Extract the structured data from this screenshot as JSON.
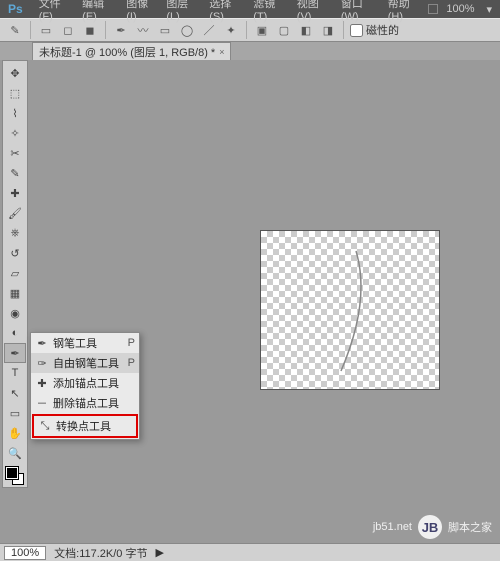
{
  "app": {
    "logo": "Ps",
    "zoom_label": "100%"
  },
  "menu": {
    "file": "文件(F)",
    "edit": "编辑(E)",
    "image": "图像(I)",
    "layer": "图层(L)",
    "select": "选择(S)",
    "filter": "滤镜(T)",
    "view": "视图(V)",
    "window": "窗口(W)",
    "help": "帮助(H)"
  },
  "options": {
    "magnetic": "磁性的"
  },
  "tab": {
    "title": "未标题-1 @ 100% (图层 1, RGB/8) *",
    "close": "×"
  },
  "tools": {
    "move": "move",
    "marquee": "marquee",
    "lasso": "lasso",
    "wand": "wand",
    "crop": "crop",
    "eyedropper": "eyedropper",
    "heal": "heal",
    "brush": "brush",
    "stamp": "stamp",
    "history": "history",
    "eraser": "eraser",
    "gradient": "gradient",
    "blur": "blur",
    "dodge": "dodge",
    "pen": "pen",
    "type": "type",
    "path": "path",
    "shape": "shape",
    "hand": "hand",
    "zoom": "zoom"
  },
  "context": {
    "pen": "钢笔工具",
    "freeform": "自由钢笔工具",
    "addpt": "添加锚点工具",
    "delpt": "删除锚点工具",
    "convert": "转换点工具",
    "shortcut": "P"
  },
  "status": {
    "zoom": "100%",
    "doc": "文档:117.2K/0 字节"
  },
  "watermark": {
    "site": "jb51.net",
    "text": "脚本之家"
  }
}
